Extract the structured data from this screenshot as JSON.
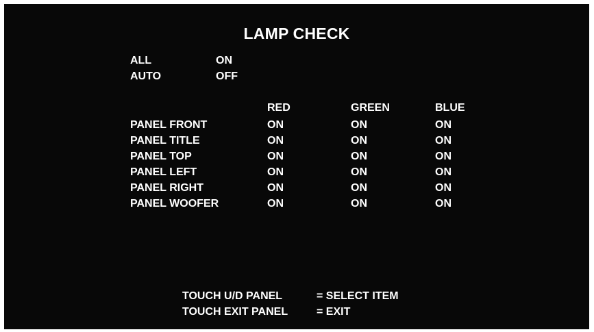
{
  "title": "LAMP CHECK",
  "global": [
    {
      "label": "ALL",
      "value": "ON"
    },
    {
      "label": "AUTO",
      "value": "OFF"
    }
  ],
  "columns": [
    "RED",
    "GREEN",
    "BLUE"
  ],
  "panels": [
    {
      "name": "PANEL FRONT",
      "red": "ON",
      "green": "ON",
      "blue": "ON"
    },
    {
      "name": "PANEL TITLE",
      "red": "ON",
      "green": "ON",
      "blue": "ON"
    },
    {
      "name": "PANEL TOP",
      "red": "ON",
      "green": "ON",
      "blue": "ON"
    },
    {
      "name": "PANEL LEFT",
      "red": "ON",
      "green": "ON",
      "blue": "ON"
    },
    {
      "name": "PANEL RIGHT",
      "red": "ON",
      "green": "ON",
      "blue": "ON"
    },
    {
      "name": "PANEL WOOFER",
      "red": "ON",
      "green": "ON",
      "blue": "ON"
    }
  ],
  "instructions": [
    {
      "key": "TOUCH U/D PANEL",
      "action": "= SELECT ITEM"
    },
    {
      "key": "TOUCH EXIT PANEL",
      "action": "= EXIT"
    }
  ],
  "colors": {
    "background": "#080808",
    "text": "#ffffff",
    "frame": "#ffffff"
  }
}
